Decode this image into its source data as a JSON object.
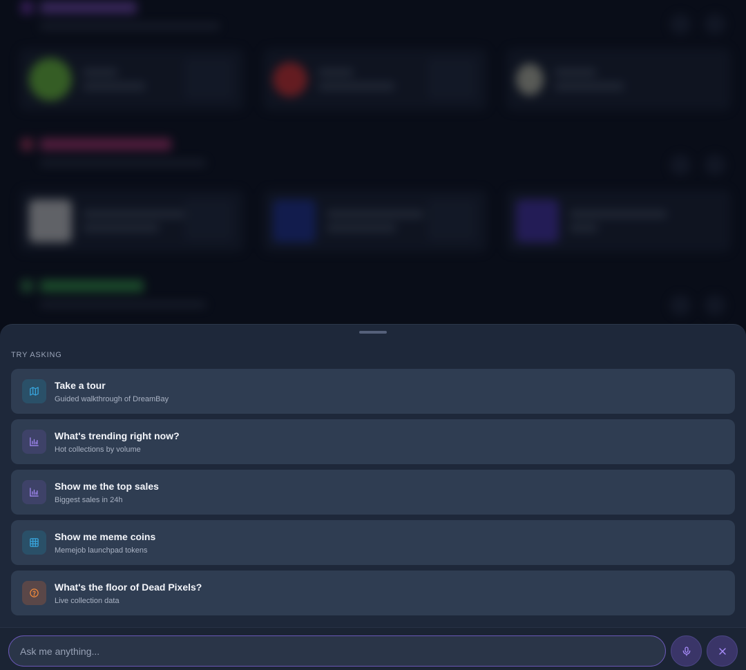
{
  "sheet": {
    "section_label": "TRY ASKING",
    "suggestions": [
      {
        "title": "Take a tour",
        "subtitle": "Guided walkthrough of DreamBay",
        "icon": "map-icon",
        "color": "#38a7e0"
      },
      {
        "title": "What's trending right now?",
        "subtitle": "Hot collections by volume",
        "icon": "bar-chart-icon",
        "color": "#a78bfa"
      },
      {
        "title": "Show me the top sales",
        "subtitle": "Biggest sales in 24h",
        "icon": "bar-chart-icon",
        "color": "#a78bfa"
      },
      {
        "title": "Show me meme coins",
        "subtitle": "Memejob launchpad tokens",
        "icon": "grid-icon",
        "color": "#38a7e0"
      },
      {
        "title": "What's the floor of Dead Pixels?",
        "subtitle": "Live collection data",
        "icon": "help-circle-icon",
        "color": "#f08a3c"
      }
    ]
  },
  "input": {
    "placeholder": "Ask me anything...",
    "value": ""
  },
  "colors": {
    "accent": "#7c63d6",
    "sheet_bg": "#1e283a",
    "card_bg": "#2f3d52",
    "page_bg": "#090d18"
  }
}
